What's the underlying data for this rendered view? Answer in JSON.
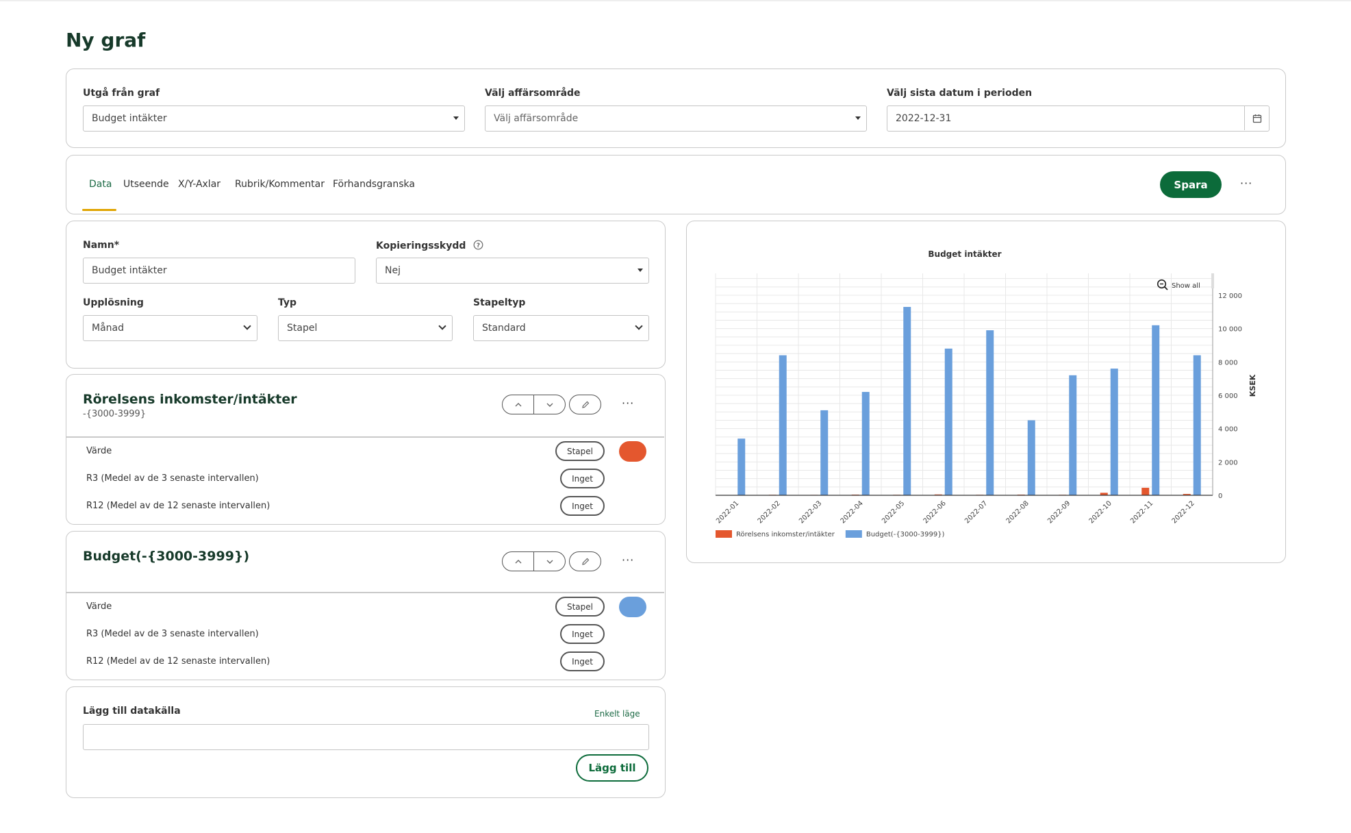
{
  "page": {
    "title": "Ny graf"
  },
  "source": {
    "graph_label": "Utgå från graf",
    "graph_value": "Budget intäkter",
    "area_label": "Välj affärsområde",
    "area_placeholder": "Välj affärsområde",
    "date_label": "Välj sista datum i perioden",
    "date_value": "2022-12-31"
  },
  "tabs": [
    {
      "label": "Data",
      "active": true
    },
    {
      "label": "Utseende",
      "active": false
    },
    {
      "label": "X/Y-Axlar",
      "active": false
    },
    {
      "label": "Rubrik/Kommentar",
      "active": false
    },
    {
      "label": "Förhandsgranska",
      "active": false
    }
  ],
  "toolbar": {
    "save_label": "Spara",
    "more_label": "···"
  },
  "settings": {
    "name_label": "Namn*",
    "name_value": "Budget intäkter",
    "copy_label": "Kopieringsskydd",
    "copy_value": "Nej",
    "resolution_label": "Upplösning",
    "resolution_value": "Månad",
    "type_label": "Typ",
    "type_value": "Stapel",
    "bartype_label": "Stapeltyp",
    "bartype_value": "Standard"
  },
  "series": [
    {
      "title": "Rörelsens inkomster/intäkter",
      "subtitle": "-{3000-3999}",
      "color": "#e4572e",
      "rows": [
        {
          "label": "Värde",
          "mode": "Stapel"
        },
        {
          "label": "R3 (Medel av de 3 senaste intervallen)",
          "mode": "Inget"
        },
        {
          "label": "R12 (Medel av de 12 senaste intervallen)",
          "mode": "Inget"
        }
      ]
    },
    {
      "title": "Budget(-{3000-3999})",
      "color": "#6a9fdc",
      "rows": [
        {
          "label": "Värde",
          "mode": "Stapel"
        },
        {
          "label": "R3 (Medel av de 3 senaste intervallen)",
          "mode": "Inget"
        },
        {
          "label": "R12 (Medel av de 12 senaste intervallen)",
          "mode": "Inget"
        }
      ]
    }
  ],
  "add_source": {
    "label": "Lägg till datakälla",
    "mode_link": "Enkelt läge",
    "button": "Lägg till"
  },
  "chart_data": {
    "type": "bar",
    "title": "Budget intäkter",
    "ylabel": "KSEK",
    "ylim": [
      0,
      12000
    ],
    "yticks": [
      "0",
      "2 000",
      "4 000",
      "6 000",
      "8 000",
      "10 000",
      "12 000"
    ],
    "zoom_label": "Show all",
    "grid": true,
    "legend": "bottom-left",
    "categories": [
      "2022-01",
      "2022-02",
      "2022-03",
      "2022-04",
      "2022-05",
      "2022-06",
      "2022-07",
      "2022-08",
      "2022-09",
      "2022-10",
      "2022-11",
      "2022-12"
    ],
    "series": [
      {
        "name": "Rörelsens inkomster/intäkter",
        "color": "#e4572e",
        "values": [
          20,
          30,
          25,
          40,
          30,
          50,
          30,
          40,
          30,
          150,
          450,
          80
        ]
      },
      {
        "name": "Budget(-{3000-3999})",
        "color": "#6a9fdc",
        "values": [
          3400,
          8400,
          5100,
          6200,
          11300,
          8800,
          9900,
          4500,
          7200,
          7600,
          10200,
          8400
        ]
      }
    ]
  }
}
